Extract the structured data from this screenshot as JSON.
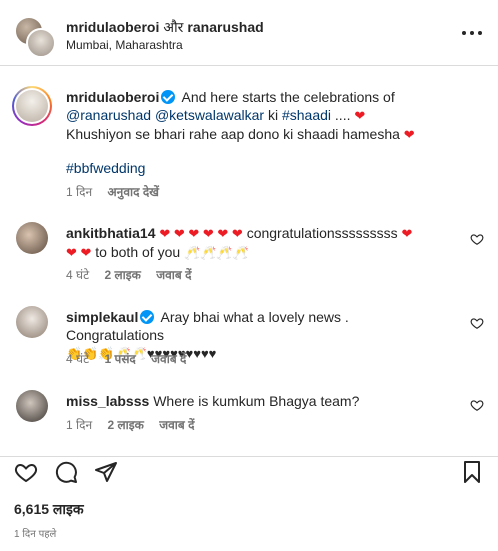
{
  "header": {
    "user1": "mridulaoberoi",
    "separator": "और",
    "user2": "ranarushad",
    "location": "Mumbai, Maharashtra",
    "more_icon": "more-horizontal-icon"
  },
  "caption": {
    "username": "mridulaoberoi",
    "text_a": "And here starts the celebrations of",
    "mention1": "@ranarushad",
    "mention2": "@ketswalawalkar",
    "text_b": "ki",
    "hashtag1": "#shaadi",
    "text_c": "....",
    "line2": "Khushiyon se bhari rahe aap dono ki shaadi hamesha",
    "hashtag2": "#bbfwedding",
    "time": "1 दिन",
    "translate": "अनुवाद देखें"
  },
  "comments": [
    {
      "username": "ankitbhatia14",
      "text_a": "congratulationsssssssss",
      "text_b": "to both of you",
      "emoji_hearts": "❤️❤️❤️❤️❤️❤️",
      "emoji_toast": "🥂🥂🥂🥂",
      "time": "4 घंटे",
      "likes": "2 लाइक",
      "reply": "जवाब दें"
    },
    {
      "username": "simplekaul",
      "text": "Aray bhai what a lovely news . Congratulations",
      "emoji_line": "👏👏👏🥂🥂♥♥♥♥♥♥♥♥♥",
      "time": "4 घंटे",
      "likes": "1 पसंद",
      "reply": "जवाब दें"
    },
    {
      "username": "miss_labsss",
      "text": "Where is kumkum Bhagya team?",
      "time": "1 दिन",
      "likes": "2 लाइक",
      "reply": "जवाब दें"
    }
  ],
  "footer": {
    "likes": "6,615 लाइक",
    "date": "1 दिन पहले"
  },
  "colors": {
    "link": "#00376b",
    "verified": "#0095f6",
    "heart": "#ed1c24",
    "muted": "#737373"
  }
}
